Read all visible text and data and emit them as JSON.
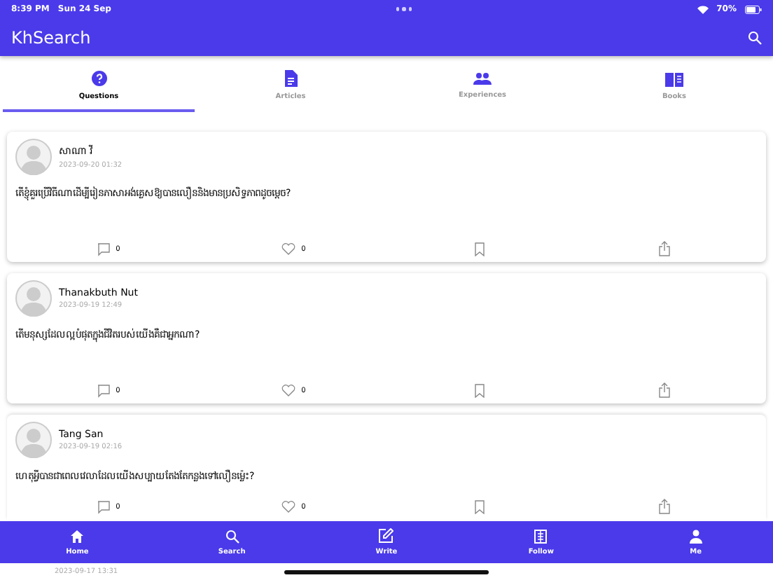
{
  "status_bar": {
    "time": "8:39 PM",
    "date": "Sun 24 Sep",
    "battery": "70%"
  },
  "app_bar": {
    "title": "KhSearch"
  },
  "tabs": [
    {
      "label": "Questions",
      "kind": "question",
      "selected": true
    },
    {
      "label": "Articles",
      "kind": "article",
      "selected": false
    },
    {
      "label": "Experiences",
      "kind": "people",
      "selected": false
    },
    {
      "label": "Books",
      "kind": "book",
      "selected": false
    }
  ],
  "posts": [
    {
      "author": "សាណា វី",
      "time": "2023-09-20 01:32",
      "question": "តើខ្ញុំគួរប្រើវិធីណាដើម្បីរៀនភាសាអង់គ្លេសឱ្យបានលឿននិងមានប្រសិទ្ធភាពដូចម្តេច?",
      "comments": "0",
      "likes": "0"
    },
    {
      "author": "Thanakbuth Nut",
      "time": "2023-09-19 12:49",
      "question": "តើមនុស្សដែលល្អបំផុតក្នុងជីវិតរបស់យើងគឺជាអ្នកណា?",
      "comments": "0",
      "likes": "0"
    },
    {
      "author": "Tang San",
      "time": "2023-09-19 02:16",
      "question": "ហេតុអ្វីបានជាពេលវេលាដែលយើងសប្បាយតែងតែកន្លងទៅលឿនម្ល៉េះ?",
      "comments": "0",
      "likes": "0"
    },
    {
      "time": "2023-09-17 13:31"
    }
  ],
  "bottom_nav": [
    {
      "label": "Home",
      "kind": "home"
    },
    {
      "label": "Search",
      "kind": "search"
    },
    {
      "label": "Write",
      "kind": "write"
    },
    {
      "label": "Follow",
      "kind": "follow"
    },
    {
      "label": "Me",
      "kind": "me"
    }
  ]
}
